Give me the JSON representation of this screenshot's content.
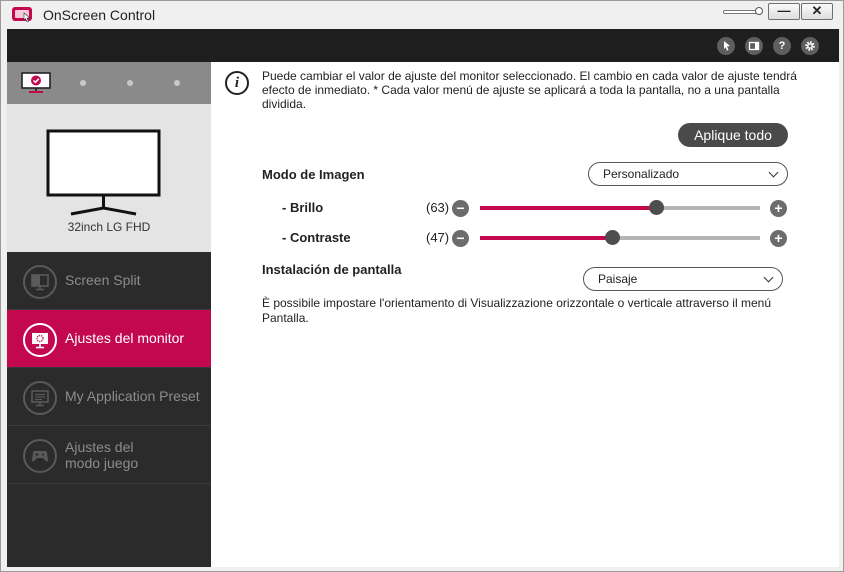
{
  "window": {
    "title": "OnScreen Control",
    "minimize_label": "—",
    "close_label": "✕"
  },
  "toolbar": {
    "icons": [
      "cursor-icon",
      "display-icon",
      "help-icon",
      "settings-icon"
    ],
    "help_glyph": "?"
  },
  "sidebar": {
    "monitor_name": "32inch LG FHD",
    "items": [
      {
        "label": "Screen Split",
        "icon": "screen-split-icon",
        "active": false
      },
      {
        "label": "Ajustes del monitor",
        "icon": "monitor-settings-icon",
        "active": true
      },
      {
        "label": "My Application Preset",
        "icon": "app-preset-icon",
        "active": false
      },
      {
        "label": "Ajustes del modo juego",
        "label_line1": "Ajustes del",
        "label_line2": "modo juego",
        "icon": "gamepad-icon",
        "active": false
      }
    ]
  },
  "main": {
    "info_glyph": "i",
    "info_text": "Puede cambiar el valor de ajuste del monitor seleccionado. El cambio en cada valor de ajuste tendrá efecto de inmediato. * Cada valor menú de ajuste se aplicará a toda la pantalla, no a una pantalla dividida.",
    "apply_all_label": "Aplique todo",
    "picture_mode": {
      "label": "Modo de Imagen",
      "value": "Personalizado"
    },
    "brightness": {
      "label": "- Brillo",
      "value_text": "(63)",
      "value": 63,
      "minus": "−",
      "plus": "+"
    },
    "contrast": {
      "label": "- Contraste",
      "value_text": "(47)",
      "value": 47,
      "minus": "−",
      "plus": "+"
    },
    "screen_install": {
      "label": "Instalación de pantalla",
      "value": "Paisaje"
    },
    "orientation_desc": "È possibile impostare l'orientamento di Visualizzazione orizzontale o verticale attraverso il menú Pantalla."
  },
  "colors": {
    "accent": "#c4084f",
    "toolbar": "#1e1e1e",
    "sidebar": "#2b2b2b"
  }
}
